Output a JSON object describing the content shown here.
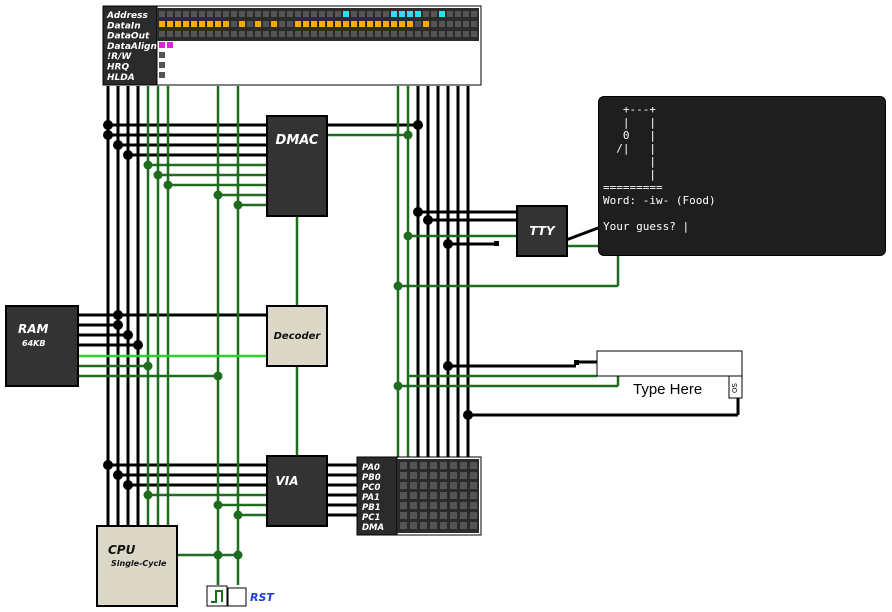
{
  "bus_monitor": {
    "signals": [
      "Address",
      "DataIn",
      "DataOut",
      "DataAlign",
      "!R/W",
      "HRQ",
      "HLDA"
    ]
  },
  "components": {
    "dmac": "DMAC",
    "tty": "TTY",
    "ram": "RAM",
    "ram_size": "64KB",
    "decoder": "Decoder",
    "via": "VIA",
    "cpu": "CPU",
    "cpu_type": "Single-Cycle",
    "via_ports": [
      "PA0",
      "PB0",
      "PC0",
      "PA1",
      "PB1",
      "PC1",
      "DMA"
    ],
    "rst": "RST"
  },
  "tty_screen": {
    "text": "   +---+\n   |   |\n   0   |\n  /|   |\n       |\n       |\n=========\nWord: -iw- (Food)\n\nYour guess? |"
  },
  "keyboard": {
    "placeholder": "Type Here",
    "side_label": "OS"
  },
  "colors": {
    "wire_black": "#000000",
    "wire_green": "#1f6b1f",
    "wire_bright_green": "#2fd12f",
    "component_dark": "#333333",
    "component_light": "#dcd8c8",
    "led_off": "#555555",
    "led_orange": "#ffaa00",
    "led_cyan": "#22e4ee",
    "led_magenta": "#e020e0",
    "tty_bg": "#1e1e1e",
    "rst_label": "#1f3fd6"
  }
}
